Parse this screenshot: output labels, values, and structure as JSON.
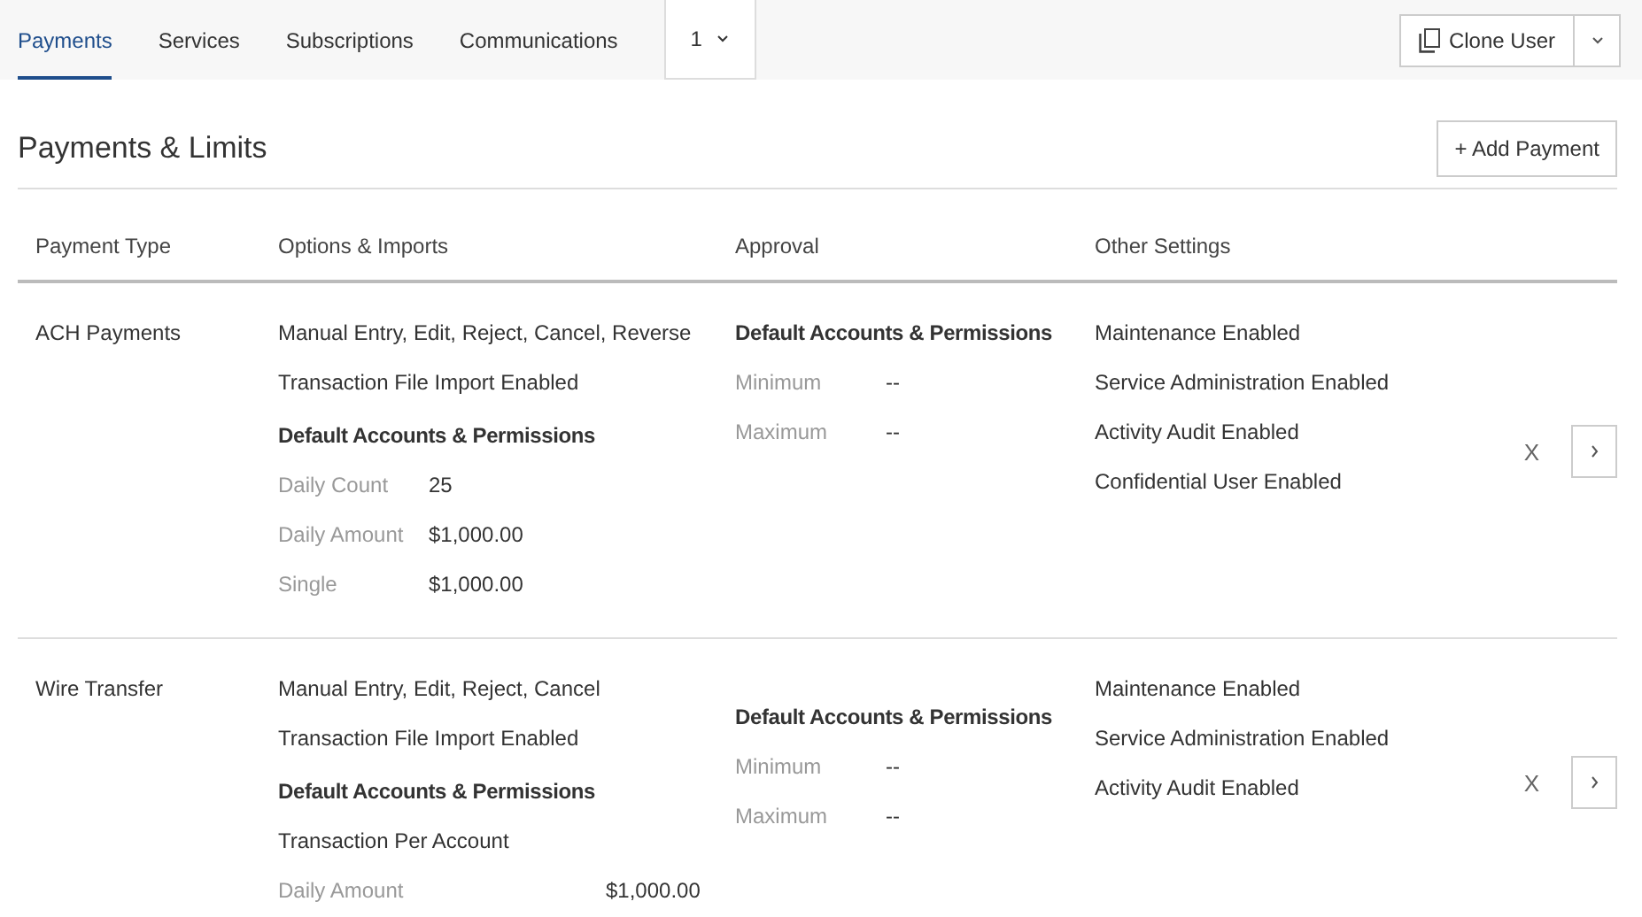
{
  "tabs": [
    {
      "label": "Payments",
      "selected": true
    },
    {
      "label": "Services",
      "selected": false
    },
    {
      "label": "Subscriptions",
      "selected": false
    },
    {
      "label": "Communications",
      "selected": false
    }
  ],
  "more_dropdown": {
    "label": "1"
  },
  "clone_user_button": {
    "label": "Clone User"
  },
  "section_title": "Payments & Limits",
  "add_payment_button": {
    "label": "+ Add Payment"
  },
  "table": {
    "columns": [
      "Payment Type",
      "Options & Imports",
      "Approval",
      "Other Settings"
    ],
    "rows": [
      {
        "payment_type": "ACH Payments",
        "options": [
          "Manual Entry, Edit, Reject, Cancel, Reverse",
          "Transaction File Import Enabled"
        ],
        "limits": {
          "heading": "Default Accounts & Permissions",
          "items": [
            {
              "label": "Daily Count",
              "value": "25"
            },
            {
              "label": "Daily Amount",
              "value": "$1,000.00"
            },
            {
              "label": "Single",
              "value": "$1,000.00"
            }
          ]
        },
        "approval": {
          "heading": "Default Accounts & Permissions",
          "items": [
            {
              "label": "Minimum",
              "value": "--"
            },
            {
              "label": "Maximum",
              "value": "--"
            }
          ]
        },
        "other_settings": [
          "Maintenance Enabled",
          "Service Administration Enabled",
          "Activity Audit Enabled",
          "Confidential User Enabled"
        ],
        "remove": "X"
      },
      {
        "payment_type": "Wire Transfer",
        "options": [
          "Manual Entry, Edit, Reject, Cancel",
          "Transaction File Import Enabled"
        ],
        "limits": {
          "heading": "Default Accounts & Permissions",
          "subheading": "Transaction Per Account",
          "items": [
            {
              "label": "Daily Amount",
              "value": "$1,000.00"
            }
          ]
        },
        "approval": {
          "heading": "Default Accounts & Permissions",
          "items": [
            {
              "label": "Minimum",
              "value": "--"
            },
            {
              "label": "Maximum",
              "value": "--"
            }
          ]
        },
        "other_settings": [
          "Maintenance Enabled",
          "Service Administration Enabled",
          "Activity Audit Enabled"
        ],
        "remove": "X"
      }
    ]
  }
}
